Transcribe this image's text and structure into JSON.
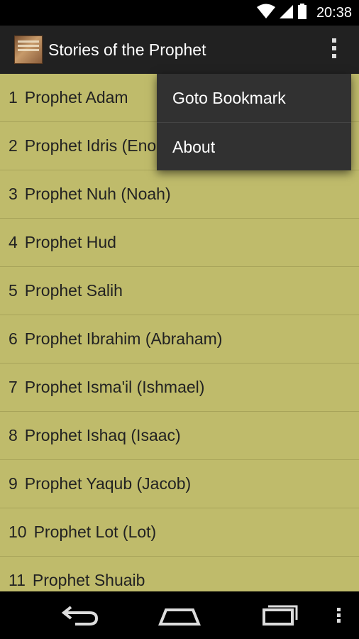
{
  "status_bar": {
    "time": "20:38"
  },
  "action_bar": {
    "title": "Stories of the Prophet"
  },
  "list": {
    "items": [
      {
        "num": "1",
        "label": "Prophet Adam"
      },
      {
        "num": "2",
        "label": "Prophet Idris (Enoch)"
      },
      {
        "num": "3",
        "label": "Prophet Nuh (Noah)"
      },
      {
        "num": "4",
        "label": "Prophet Hud"
      },
      {
        "num": "5",
        "label": "Prophet Salih"
      },
      {
        "num": "6",
        "label": "Prophet Ibrahim (Abraham)"
      },
      {
        "num": "7",
        "label": "Prophet Isma'il (Ishmael)"
      },
      {
        "num": "8",
        "label": "Prophet Ishaq (Isaac)"
      },
      {
        "num": "9",
        "label": "Prophet Yaqub (Jacob)"
      },
      {
        "num": "10",
        "label": "Prophet Lot (Lot)"
      },
      {
        "num": "11",
        "label": "Prophet Shuaib"
      }
    ]
  },
  "overflow_menu": {
    "items": [
      {
        "label": "Goto Bookmark"
      },
      {
        "label": "About"
      }
    ]
  },
  "colors": {
    "list_background": "#bfbb6b",
    "action_bar": "#212121",
    "popup_background": "#313131"
  },
  "icons": {
    "status": [
      "wifi-icon",
      "cell-signal-icon",
      "battery-icon"
    ],
    "nav": [
      "back-icon",
      "home-icon",
      "recent-apps-icon",
      "menu-icon"
    ]
  }
}
